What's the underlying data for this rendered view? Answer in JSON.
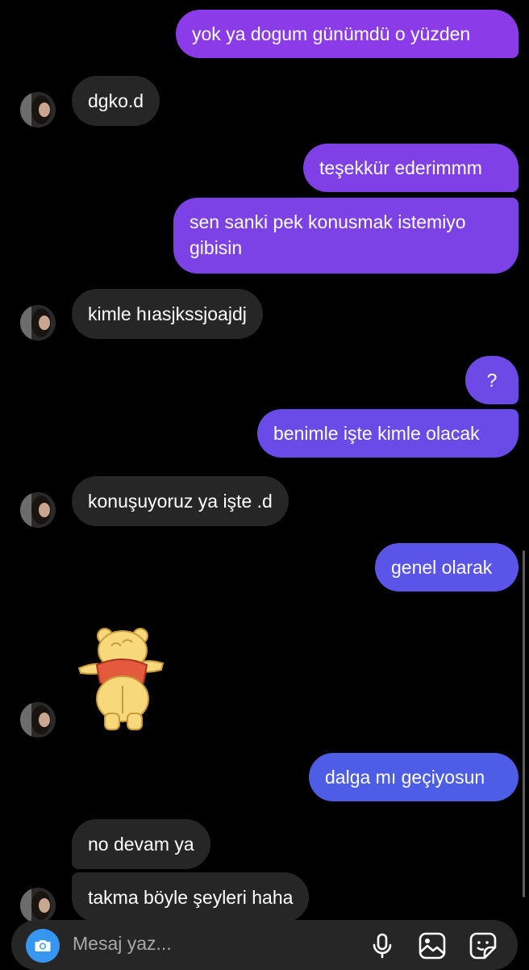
{
  "messages": [
    {
      "from": "me",
      "text": "yok ya dogum günümdü o yüzden",
      "color": "#8b3ce8"
    },
    {
      "from": "them",
      "text": "dgko.d"
    },
    {
      "from": "me",
      "text": "teşekkür ederimmm",
      "color": "#7f40e6"
    },
    {
      "from": "me",
      "line1": "sen sanki pek konusmak istemiyo",
      "line2": "gibisin",
      "color": "#7c42e5"
    },
    {
      "from": "them",
      "text": "kimle hıasjkssjoajdj"
    },
    {
      "from": "me",
      "text": "?",
      "color": "#6d4ae6"
    },
    {
      "from": "me",
      "text": "benimle işte kimle olacak",
      "color": "#6a4be7"
    },
    {
      "from": "them",
      "text": "konuşuyoruz ya işte .d"
    },
    {
      "from": "me",
      "text": "genel olarak",
      "color": "#5a55e8"
    },
    {
      "from": "them",
      "sticker": "winnie-the-pooh-dancing"
    },
    {
      "from": "me",
      "text": "dalga mı geçiyosun",
      "color": "#4e5de6"
    },
    {
      "from": "them",
      "text": "no devam ya"
    },
    {
      "from": "them",
      "text": "takma böyle şeyleri haha"
    }
  ],
  "composer": {
    "placeholder": "Mesaj yaz...",
    "camera_icon": "camera-icon",
    "mic_icon": "microphone-icon",
    "gallery_icon": "image-gallery-icon",
    "sticker_icon": "sticker-icon",
    "accent": "#3797f0"
  }
}
